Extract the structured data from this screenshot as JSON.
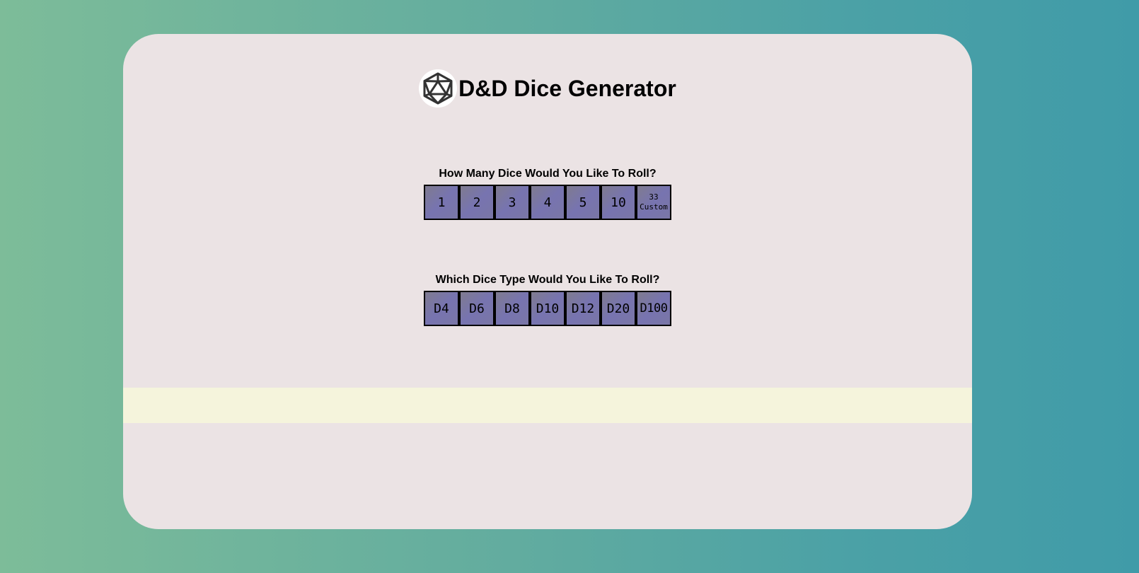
{
  "header": {
    "title": "D&D Dice Generator",
    "logo_icon": "d20-icon"
  },
  "count_section": {
    "question": "How Many Dice Would You Like To Roll?",
    "options": [
      "1",
      "2",
      "3",
      "4",
      "5",
      "10"
    ],
    "custom": {
      "value": "33",
      "label": "Custom"
    }
  },
  "type_section": {
    "question": "Which Dice Type Would You Like To Roll?",
    "options": [
      "D4",
      "D6",
      "D8",
      "D10",
      "D12",
      "D20",
      "D100"
    ]
  },
  "colors": {
    "card_background": "#ebe3e4",
    "button_fill": "#7774b0",
    "result_band": "#f5f4dc"
  }
}
